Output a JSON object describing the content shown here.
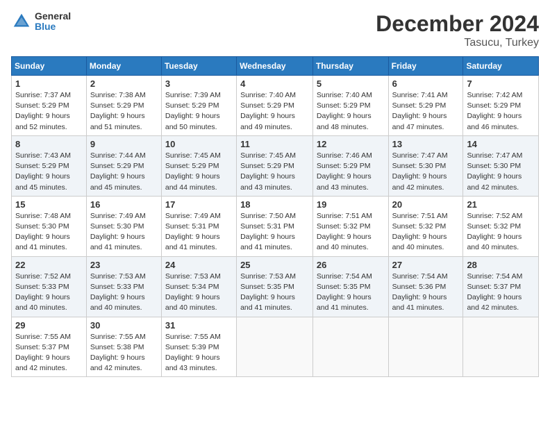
{
  "header": {
    "logo_line1": "General",
    "logo_line2": "Blue",
    "title": "December 2024",
    "subtitle": "Tasucu, Turkey"
  },
  "columns": [
    "Sunday",
    "Monday",
    "Tuesday",
    "Wednesday",
    "Thursday",
    "Friday",
    "Saturday"
  ],
  "weeks": [
    [
      {
        "day": "1",
        "sunrise": "7:37 AM",
        "sunset": "5:29 PM",
        "daylight": "9 hours and 52 minutes."
      },
      {
        "day": "2",
        "sunrise": "7:38 AM",
        "sunset": "5:29 PM",
        "daylight": "9 hours and 51 minutes."
      },
      {
        "day": "3",
        "sunrise": "7:39 AM",
        "sunset": "5:29 PM",
        "daylight": "9 hours and 50 minutes."
      },
      {
        "day": "4",
        "sunrise": "7:40 AM",
        "sunset": "5:29 PM",
        "daylight": "9 hours and 49 minutes."
      },
      {
        "day": "5",
        "sunrise": "7:40 AM",
        "sunset": "5:29 PM",
        "daylight": "9 hours and 48 minutes."
      },
      {
        "day": "6",
        "sunrise": "7:41 AM",
        "sunset": "5:29 PM",
        "daylight": "9 hours and 47 minutes."
      },
      {
        "day": "7",
        "sunrise": "7:42 AM",
        "sunset": "5:29 PM",
        "daylight": "9 hours and 46 minutes."
      }
    ],
    [
      {
        "day": "8",
        "sunrise": "7:43 AM",
        "sunset": "5:29 PM",
        "daylight": "9 hours and 45 minutes."
      },
      {
        "day": "9",
        "sunrise": "7:44 AM",
        "sunset": "5:29 PM",
        "daylight": "9 hours and 45 minutes."
      },
      {
        "day": "10",
        "sunrise": "7:45 AM",
        "sunset": "5:29 PM",
        "daylight": "9 hours and 44 minutes."
      },
      {
        "day": "11",
        "sunrise": "7:45 AM",
        "sunset": "5:29 PM",
        "daylight": "9 hours and 43 minutes."
      },
      {
        "day": "12",
        "sunrise": "7:46 AM",
        "sunset": "5:29 PM",
        "daylight": "9 hours and 43 minutes."
      },
      {
        "day": "13",
        "sunrise": "7:47 AM",
        "sunset": "5:30 PM",
        "daylight": "9 hours and 42 minutes."
      },
      {
        "day": "14",
        "sunrise": "7:47 AM",
        "sunset": "5:30 PM",
        "daylight": "9 hours and 42 minutes."
      }
    ],
    [
      {
        "day": "15",
        "sunrise": "7:48 AM",
        "sunset": "5:30 PM",
        "daylight": "9 hours and 41 minutes."
      },
      {
        "day": "16",
        "sunrise": "7:49 AM",
        "sunset": "5:30 PM",
        "daylight": "9 hours and 41 minutes."
      },
      {
        "day": "17",
        "sunrise": "7:49 AM",
        "sunset": "5:31 PM",
        "daylight": "9 hours and 41 minutes."
      },
      {
        "day": "18",
        "sunrise": "7:50 AM",
        "sunset": "5:31 PM",
        "daylight": "9 hours and 41 minutes."
      },
      {
        "day": "19",
        "sunrise": "7:51 AM",
        "sunset": "5:32 PM",
        "daylight": "9 hours and 40 minutes."
      },
      {
        "day": "20",
        "sunrise": "7:51 AM",
        "sunset": "5:32 PM",
        "daylight": "9 hours and 40 minutes."
      },
      {
        "day": "21",
        "sunrise": "7:52 AM",
        "sunset": "5:32 PM",
        "daylight": "9 hours and 40 minutes."
      }
    ],
    [
      {
        "day": "22",
        "sunrise": "7:52 AM",
        "sunset": "5:33 PM",
        "daylight": "9 hours and 40 minutes."
      },
      {
        "day": "23",
        "sunrise": "7:53 AM",
        "sunset": "5:33 PM",
        "daylight": "9 hours and 40 minutes."
      },
      {
        "day": "24",
        "sunrise": "7:53 AM",
        "sunset": "5:34 PM",
        "daylight": "9 hours and 40 minutes."
      },
      {
        "day": "25",
        "sunrise": "7:53 AM",
        "sunset": "5:35 PM",
        "daylight": "9 hours and 41 minutes."
      },
      {
        "day": "26",
        "sunrise": "7:54 AM",
        "sunset": "5:35 PM",
        "daylight": "9 hours and 41 minutes."
      },
      {
        "day": "27",
        "sunrise": "7:54 AM",
        "sunset": "5:36 PM",
        "daylight": "9 hours and 41 minutes."
      },
      {
        "day": "28",
        "sunrise": "7:54 AM",
        "sunset": "5:37 PM",
        "daylight": "9 hours and 42 minutes."
      }
    ],
    [
      {
        "day": "29",
        "sunrise": "7:55 AM",
        "sunset": "5:37 PM",
        "daylight": "9 hours and 42 minutes."
      },
      {
        "day": "30",
        "sunrise": "7:55 AM",
        "sunset": "5:38 PM",
        "daylight": "9 hours and 42 minutes."
      },
      {
        "day": "31",
        "sunrise": "7:55 AM",
        "sunset": "5:39 PM",
        "daylight": "9 hours and 43 minutes."
      },
      null,
      null,
      null,
      null
    ]
  ]
}
